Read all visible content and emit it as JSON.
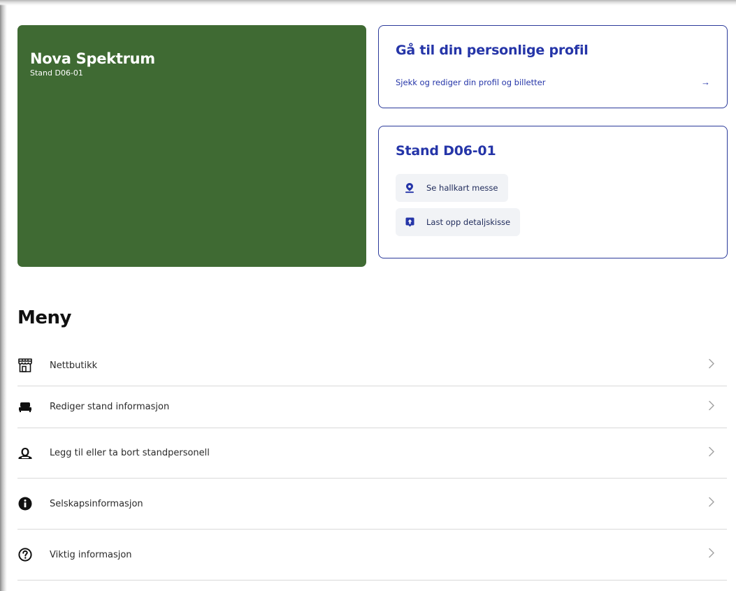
{
  "company": {
    "name": "Nova Spektrum",
    "stand": "Stand D06-01",
    "color": "#3f6a33"
  },
  "profile_card": {
    "title": "Gå til din personlige profil",
    "subtitle": "Sjekk og rediger din profil og billetter",
    "arrow": "→"
  },
  "stand_card": {
    "title": "Stand D06-01",
    "buttons": [
      {
        "label": "Se hallkart messe",
        "icon": "map-pin-icon"
      },
      {
        "label": "Last opp detaljskisse",
        "icon": "upload-icon"
      }
    ]
  },
  "menu": {
    "heading": "Meny",
    "items": [
      {
        "label": "Nettbutikk",
        "icon": "store-icon"
      },
      {
        "label": "Rediger stand informasjon",
        "icon": "stand-icon"
      },
      {
        "label": "Legg til eller ta bort standpersonell",
        "icon": "personnel-icon"
      },
      {
        "label": "Selskapsinformasjon",
        "icon": "info-icon"
      },
      {
        "label": "Viktig informasjon",
        "icon": "question-icon"
      }
    ]
  },
  "colors": {
    "accent": "#2535a8",
    "border": "#2b3a9a",
    "button_bg": "#f1f3f6",
    "divider": "#d9d9d9"
  }
}
